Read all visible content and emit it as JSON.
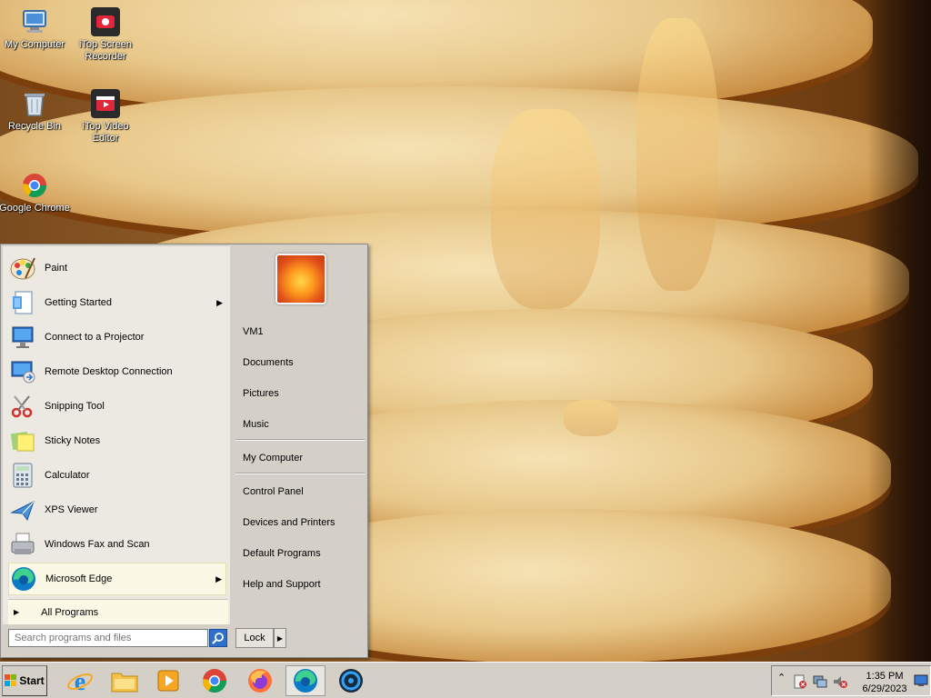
{
  "desktop": {
    "icons": [
      {
        "label": "My Computer"
      },
      {
        "label": "iTop Screen Recorder"
      },
      {
        "label": "Recycle Bin"
      },
      {
        "label": "iTop Video Editor"
      },
      {
        "label": "Google Chrome"
      }
    ]
  },
  "start_menu": {
    "programs": [
      {
        "label": "Paint",
        "icon": "paint-icon"
      },
      {
        "label": "Getting Started",
        "icon": "getting-started-icon",
        "has_submenu": true
      },
      {
        "label": "Connect to a Projector",
        "icon": "projector-icon"
      },
      {
        "label": "Remote Desktop Connection",
        "icon": "remote-desktop-icon"
      },
      {
        "label": "Snipping Tool",
        "icon": "scissors-icon"
      },
      {
        "label": "Sticky Notes",
        "icon": "sticky-notes-icon"
      },
      {
        "label": "Calculator",
        "icon": "calculator-icon"
      },
      {
        "label": "XPS Viewer",
        "icon": "xps-viewer-icon"
      },
      {
        "label": "Windows Fax and Scan",
        "icon": "fax-scan-icon"
      },
      {
        "label": "Microsoft Edge",
        "icon": "edge-icon",
        "has_submenu": true,
        "highlighted": true
      }
    ],
    "all_programs": "All Programs",
    "places": [
      {
        "label": "VM1"
      },
      {
        "label": "Documents"
      },
      {
        "label": "Pictures"
      },
      {
        "label": "Music"
      },
      {
        "label": "My Computer"
      },
      {
        "label": "Control Panel"
      },
      {
        "label": "Devices and Printers"
      },
      {
        "label": "Default Programs"
      },
      {
        "label": "Help and Support"
      }
    ],
    "search_placeholder": "Search programs and files",
    "lock_label": "Lock"
  },
  "taskbar": {
    "start_label": "Start",
    "pinned": [
      "internet-explorer-icon",
      "file-explorer-icon",
      "media-player-icon",
      "chrome-icon",
      "firefox-icon",
      "edge-icon",
      "itop-recorder-icon"
    ],
    "clock_time": "1:35 PM",
    "clock_date": "6/29/2023"
  },
  "colors": {
    "menu_bg": "#d4d0c8",
    "highlight": "#fbf9e6",
    "search_button": "#2d6fcb"
  }
}
